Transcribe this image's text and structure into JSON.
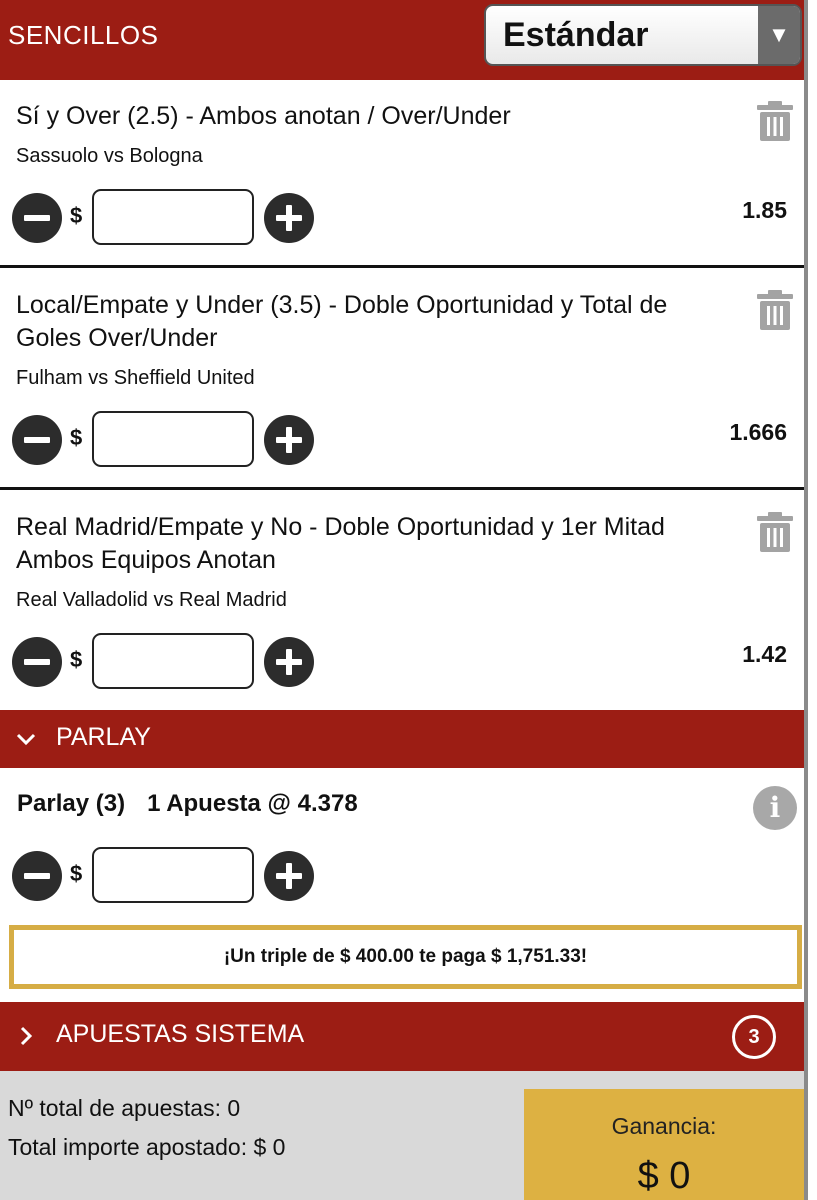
{
  "header": {
    "title": "SENCILLOS",
    "mode_select": {
      "value": "Estándar",
      "arrow": "▼"
    }
  },
  "bets": [
    {
      "selection": "Sí y Over (2.5) - Ambos anotan / Over/Under",
      "match": "Sassuolo vs Bologna",
      "odds": "1.85",
      "currency": "$",
      "stake": ""
    },
    {
      "selection": "Local/Empate y Under (3.5) - Doble Oportunidad y Total de Goles Over/Under",
      "match": "Fulham vs Sheffield United",
      "odds": "1.666",
      "currency": "$",
      "stake": ""
    },
    {
      "selection": "Real Madrid/Empate y No - Doble Oportunidad y 1er Mitad Ambos Equipos Anotan",
      "match": "Real Valladolid vs Real Madrid",
      "odds": "1.42",
      "currency": "$",
      "stake": ""
    }
  ],
  "parlay": {
    "section_label": "PARLAY",
    "title": "Parlay (3)",
    "summary": "1 Apuesta @ 4.378",
    "currency": "$",
    "stake": "",
    "promo": "¡Un triple de $ 400.00 te paga $ 1,751.33!"
  },
  "system": {
    "section_label": "APUESTAS SISTEMA",
    "count": "3"
  },
  "footer": {
    "total_bets": "Nº total de apuestas: 0",
    "total_staked": "Total importe apostado: $ 0",
    "gain_label": "Ganancia:",
    "gain_value": "$ 0"
  },
  "colors": {
    "header_red": "#9c1d14",
    "gain_gold": "#ddb142",
    "promo_border": "#d6ad45",
    "footer_gray": "#d9d9d9"
  },
  "icons": {
    "delete": "trash-icon",
    "decrease": "minus-circle-icon",
    "increase": "plus-circle-icon",
    "info": "info-icon",
    "expanded": "chevron-down-icon",
    "collapsed": "chevron-right-icon"
  }
}
